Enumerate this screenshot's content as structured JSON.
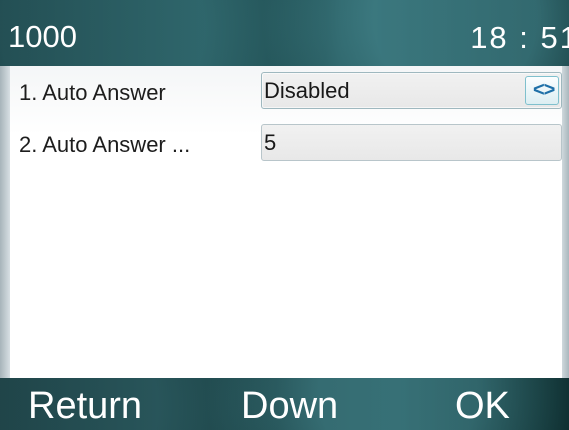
{
  "status_bar": {
    "account": "1000",
    "time": "18 : 51"
  },
  "settings": {
    "items": [
      {
        "label": "1.  Auto Answer",
        "value": "Disabled",
        "control": "selector",
        "control_icon": "left-right-arrows-icon",
        "control_glyph": "<>"
      },
      {
        "label": "2.  Auto Answer ...",
        "value": "5",
        "control": "input"
      }
    ]
  },
  "softkeys": [
    {
      "label": "Return"
    },
    {
      "label": "Down"
    },
    {
      "label": "OK"
    }
  ],
  "colors": {
    "bar_dark": "#1b4649",
    "arrow_blue": "#1e70a8",
    "field_bg": "#e8e8e8"
  }
}
